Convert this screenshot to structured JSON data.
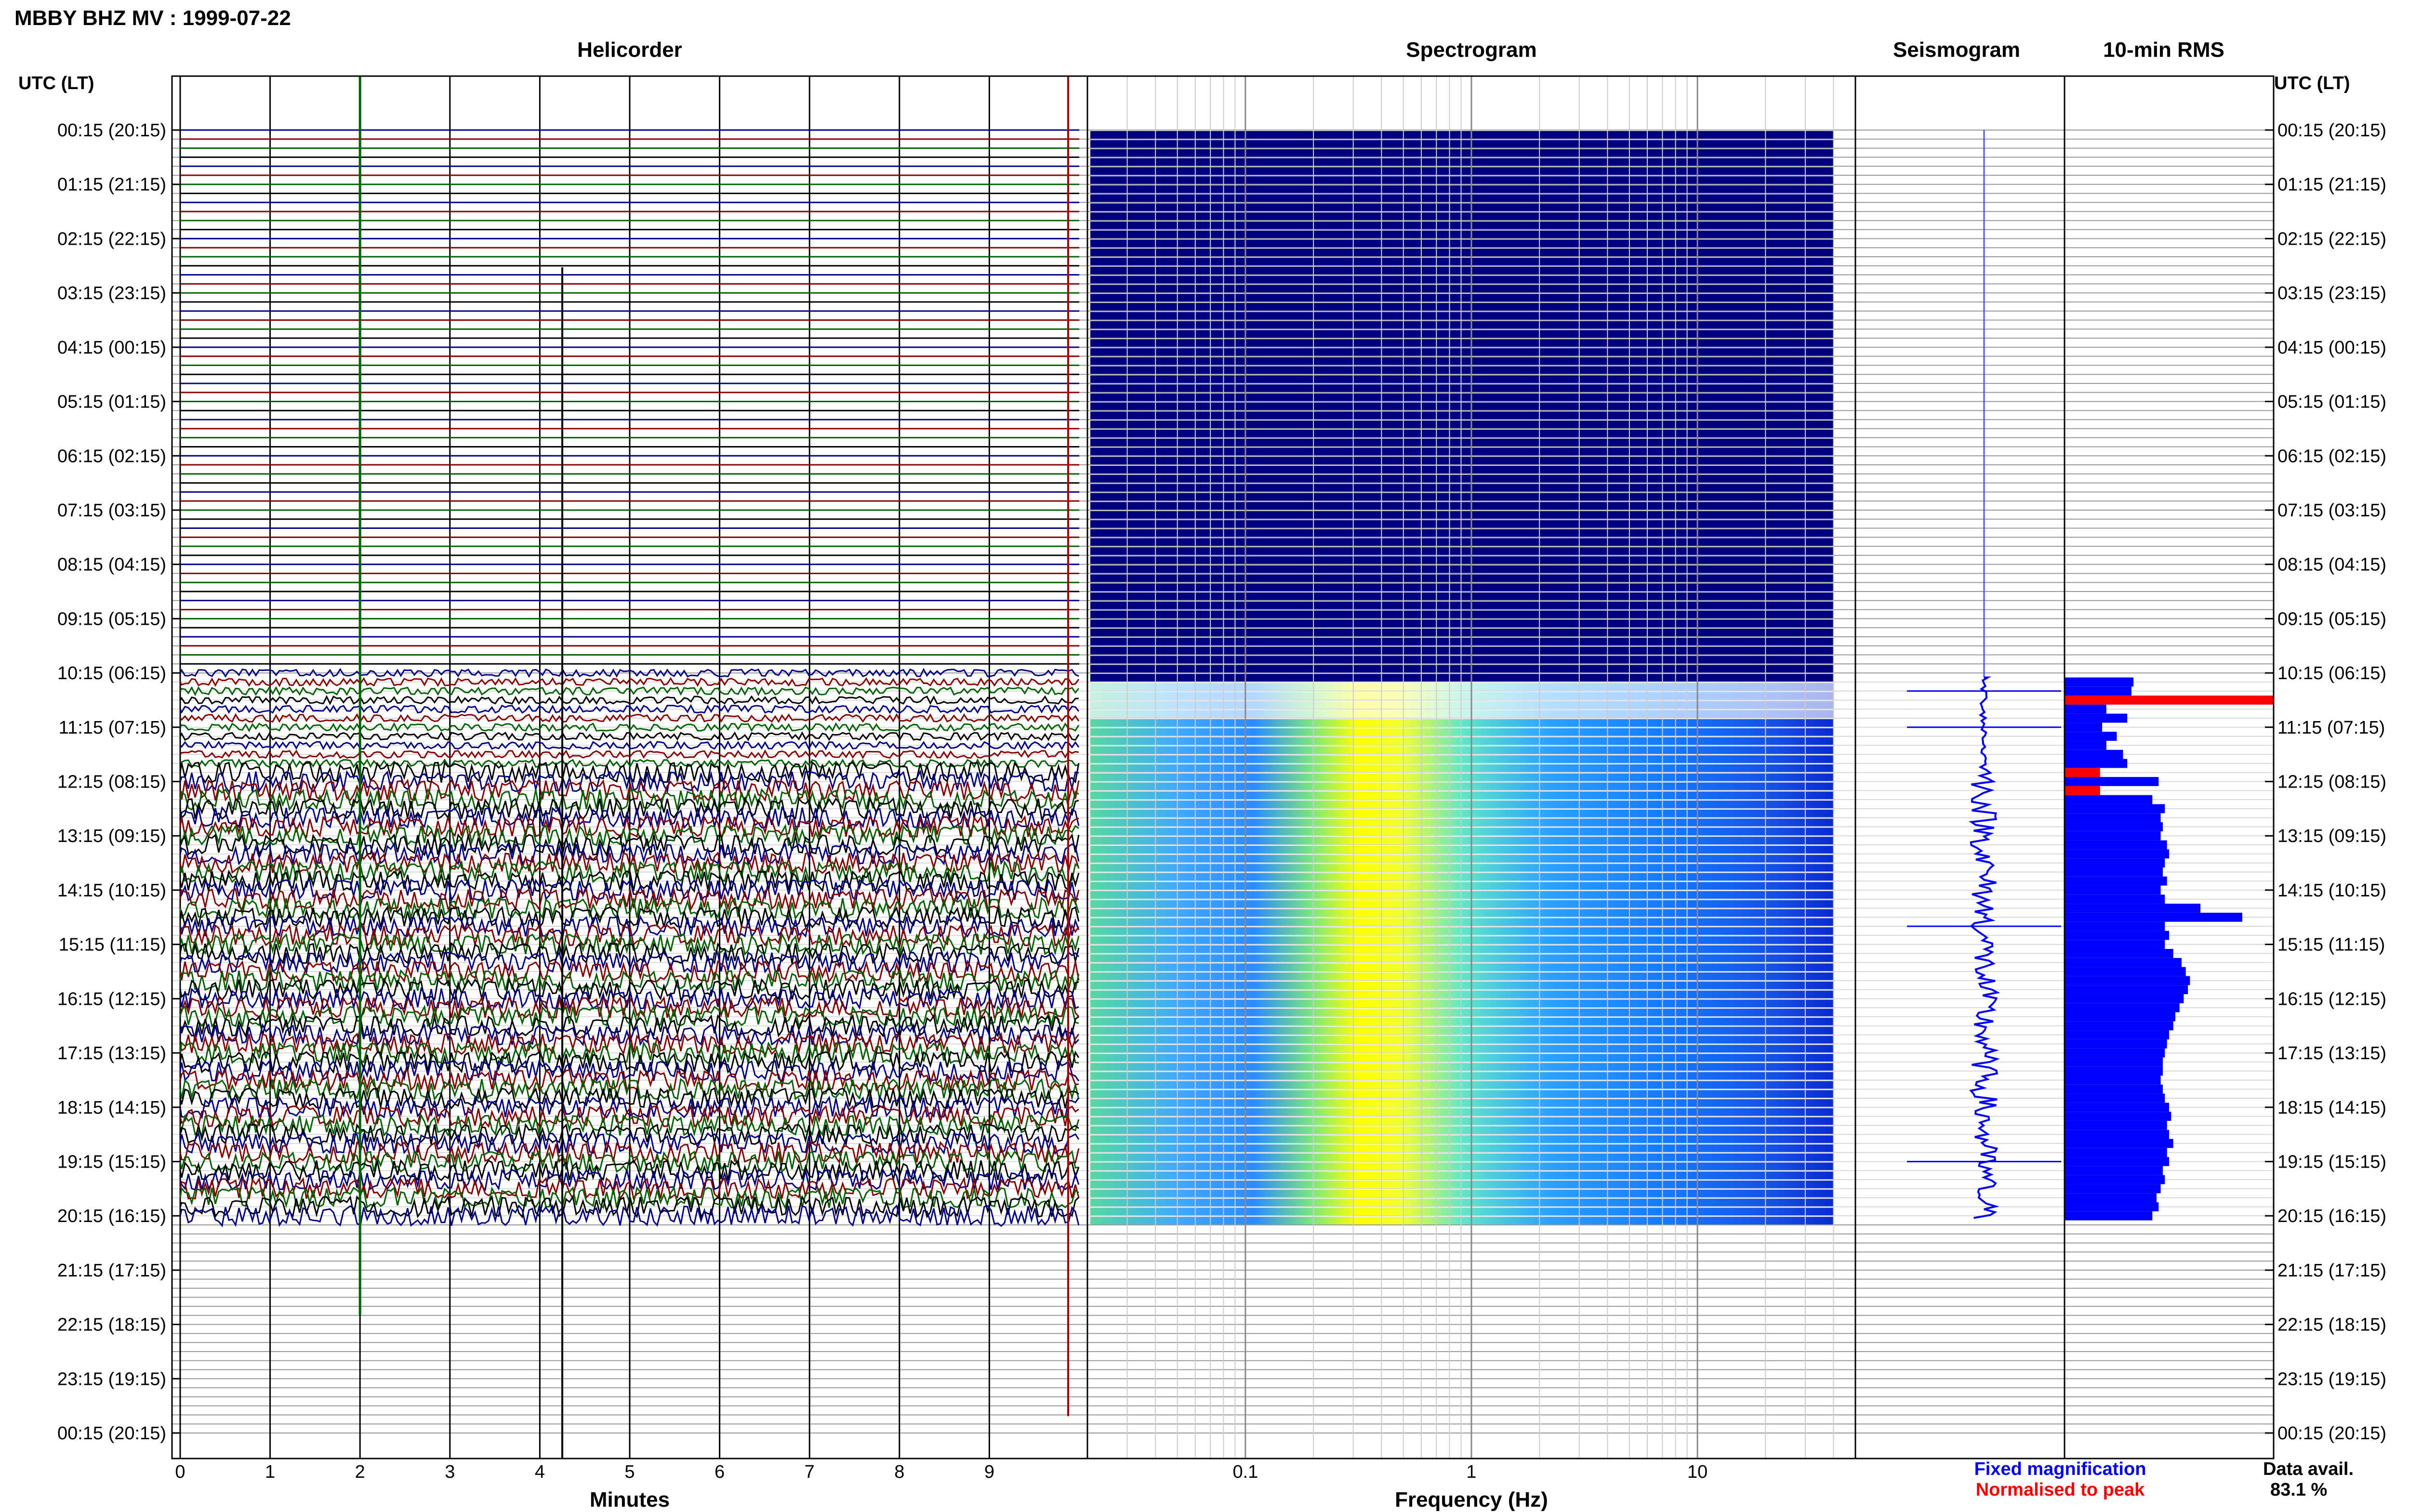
{
  "title": "MBBY BHZ MV : 1999-07-22",
  "panel_titles": {
    "helicorder": "Helicorder",
    "spectrogram": "Spectrogram",
    "seismogram": "Seismogram",
    "rms": "10-min RMS"
  },
  "axis_headers": {
    "left": "UTC (LT)",
    "right": "UTC (LT)"
  },
  "xlabels": {
    "helicorder": "Minutes",
    "spectrogram": "Frequency (Hz)"
  },
  "legend": {
    "fixed": "Fixed magnification",
    "fixed_color": "#0000ff",
    "normalised": "Normalised to peak",
    "normalised_color": "#ff0000"
  },
  "data_avail": {
    "label": "Data avail.",
    "value": "83.1 %"
  },
  "colors": {
    "trace_cycle": [
      "#00008b",
      "#8b0000",
      "#006400",
      "#000000"
    ],
    "spectrogram_low": "#00007f",
    "spectrogram_peak": "#ffff00",
    "rms_fill": "#0000ff",
    "rms_highlight": "#ff0000"
  },
  "chart_data": {
    "type": "heatmap",
    "date": "1999-07-22",
    "station": "MBBY BHZ MV",
    "time_labels": [
      "00:15 (20:15)",
      "01:15 (21:15)",
      "02:15 (22:15)",
      "03:15 (23:15)",
      "04:15 (00:15)",
      "05:15 (01:15)",
      "06:15 (02:15)",
      "07:15 (03:15)",
      "08:15 (04:15)",
      "09:15 (05:15)",
      "10:15 (06:15)",
      "11:15 (07:15)",
      "12:15 (08:15)",
      "13:15 (09:15)",
      "14:15 (10:15)",
      "15:15 (11:15)",
      "16:15 (12:15)",
      "17:15 (13:15)",
      "18:15 (14:15)",
      "19:15 (15:15)",
      "20:15 (16:15)",
      "21:15 (17:15)",
      "22:15 (18:15)",
      "23:15 (19:15)",
      "00:15 (20:15)"
    ],
    "helicorder_x_ticks": [
      "0",
      "1",
      "2",
      "3",
      "4",
      "5",
      "6",
      "7",
      "8",
      "9"
    ],
    "helicorder_xlim": [
      0,
      10
    ],
    "spectrogram_x_ticks": [
      "0.1",
      "1",
      "10"
    ],
    "spectrogram_xlim": [
      0.02,
      50
    ],
    "spectrogram_xscale": "log",
    "data_start": "10:20",
    "data_end": "20:20",
    "peak_frequency_band_hz": [
      0.3,
      0.5
    ],
    "seismogram_events_utc": [
      "10:35",
      "11:15",
      "14:55",
      "19:15"
    ],
    "rms": [
      {
        "time": "10:20",
        "value": 0.33,
        "normalised": false
      },
      {
        "time": "10:30",
        "value": 0.32,
        "normalised": false
      },
      {
        "time": "10:40",
        "value": 1.0,
        "normalised": true
      },
      {
        "time": "10:50",
        "value": 0.2,
        "normalised": false
      },
      {
        "time": "11:00",
        "value": 0.3,
        "normalised": false
      },
      {
        "time": "11:10",
        "value": 0.18,
        "normalised": false
      },
      {
        "time": "11:20",
        "value": 0.25,
        "normalised": false
      },
      {
        "time": "11:30",
        "value": 0.2,
        "normalised": false
      },
      {
        "time": "11:40",
        "value": 0.28,
        "normalised": false
      },
      {
        "time": "11:50",
        "value": 0.3,
        "normalised": false
      },
      {
        "time": "12:00",
        "value": 0.17,
        "normalised": true
      },
      {
        "time": "12:10",
        "value": 0.45,
        "normalised": false
      },
      {
        "time": "12:20",
        "value": 0.17,
        "normalised": true
      },
      {
        "time": "12:30",
        "value": 0.42,
        "normalised": false
      },
      {
        "time": "12:40",
        "value": 0.48,
        "normalised": false
      },
      {
        "time": "12:50",
        "value": 0.46,
        "normalised": false
      },
      {
        "time": "13:00",
        "value": 0.47,
        "normalised": false
      },
      {
        "time": "13:10",
        "value": 0.46,
        "normalised": false
      },
      {
        "time": "13:20",
        "value": 0.49,
        "normalised": false
      },
      {
        "time": "13:30",
        "value": 0.5,
        "normalised": false
      },
      {
        "time": "13:40",
        "value": 0.48,
        "normalised": false
      },
      {
        "time": "13:50",
        "value": 0.47,
        "normalised": false
      },
      {
        "time": "14:00",
        "value": 0.49,
        "normalised": false
      },
      {
        "time": "14:10",
        "value": 0.46,
        "normalised": false
      },
      {
        "time": "14:20",
        "value": 0.48,
        "normalised": false
      },
      {
        "time": "14:30",
        "value": 0.65,
        "normalised": false
      },
      {
        "time": "14:40",
        "value": 0.85,
        "normalised": false
      },
      {
        "time": "14:50",
        "value": 0.48,
        "normalised": false
      },
      {
        "time": "15:00",
        "value": 0.5,
        "normalised": false
      },
      {
        "time": "15:10",
        "value": 0.48,
        "normalised": false
      },
      {
        "time": "15:20",
        "value": 0.52,
        "normalised": false
      },
      {
        "time": "15:30",
        "value": 0.56,
        "normalised": false
      },
      {
        "time": "15:40",
        "value": 0.58,
        "normalised": false
      },
      {
        "time": "15:50",
        "value": 0.6,
        "normalised": false
      },
      {
        "time": "16:00",
        "value": 0.59,
        "normalised": false
      },
      {
        "time": "16:10",
        "value": 0.57,
        "normalised": false
      },
      {
        "time": "16:20",
        "value": 0.55,
        "normalised": false
      },
      {
        "time": "16:30",
        "value": 0.53,
        "normalised": false
      },
      {
        "time": "16:40",
        "value": 0.52,
        "normalised": false
      },
      {
        "time": "16:50",
        "value": 0.5,
        "normalised": false
      },
      {
        "time": "17:00",
        "value": 0.49,
        "normalised": false
      },
      {
        "time": "17:10",
        "value": 0.48,
        "normalised": false
      },
      {
        "time": "17:20",
        "value": 0.47,
        "normalised": false
      },
      {
        "time": "17:30",
        "value": 0.47,
        "normalised": false
      },
      {
        "time": "17:40",
        "value": 0.46,
        "normalised": false
      },
      {
        "time": "17:50",
        "value": 0.47,
        "normalised": false
      },
      {
        "time": "18:00",
        "value": 0.48,
        "normalised": false
      },
      {
        "time": "18:10",
        "value": 0.5,
        "normalised": false
      },
      {
        "time": "18:20",
        "value": 0.51,
        "normalised": false
      },
      {
        "time": "18:30",
        "value": 0.49,
        "normalised": false
      },
      {
        "time": "18:40",
        "value": 0.5,
        "normalised": false
      },
      {
        "time": "18:50",
        "value": 0.52,
        "normalised": false
      },
      {
        "time": "19:00",
        "value": 0.49,
        "normalised": false
      },
      {
        "time": "19:10",
        "value": 0.5,
        "normalised": false
      },
      {
        "time": "19:20",
        "value": 0.47,
        "normalised": false
      },
      {
        "time": "19:30",
        "value": 0.48,
        "normalised": false
      },
      {
        "time": "19:40",
        "value": 0.46,
        "normalised": false
      },
      {
        "time": "19:50",
        "value": 0.44,
        "normalised": false
      },
      {
        "time": "20:00",
        "value": 0.45,
        "normalised": false
      },
      {
        "time": "20:10",
        "value": 0.42,
        "normalised": false
      }
    ]
  }
}
